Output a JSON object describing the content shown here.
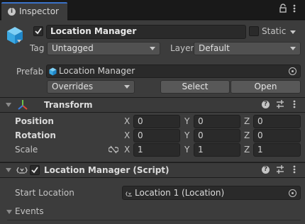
{
  "tab": {
    "title": "Inspector"
  },
  "object": {
    "name": "Location Manager",
    "static_label": "Static",
    "tag_label": "Tag",
    "tag_value": "Untagged",
    "layer_label": "Layer",
    "layer_value": "Default"
  },
  "prefab": {
    "label": "Prefab",
    "asset_name": "Location Manager",
    "overrides_label": "Overrides",
    "select_label": "Select",
    "open_label": "Open"
  },
  "transform": {
    "title": "Transform",
    "rows": [
      {
        "label": "Position",
        "x": "0",
        "y": "0",
        "z": "0"
      },
      {
        "label": "Rotation",
        "x": "0",
        "y": "0",
        "z": "0"
      },
      {
        "label": "Scale",
        "x": "1",
        "y": "1",
        "z": "1"
      }
    ],
    "axis_x": "X",
    "axis_y": "Y",
    "axis_z": "Z"
  },
  "script": {
    "title": "Location Manager (Script)",
    "start_location_label": "Start Location",
    "start_location_value": "Location 1 (Location)",
    "events_label": "Events"
  }
}
